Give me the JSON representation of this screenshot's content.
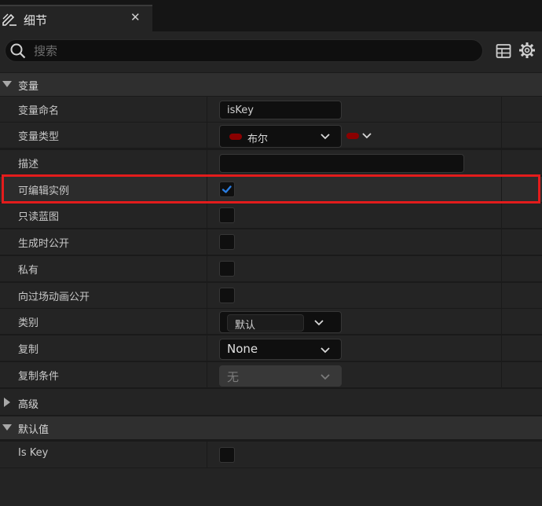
{
  "panel": {
    "title": "细节"
  },
  "search": {
    "placeholder": "搜索"
  },
  "sections": {
    "variable": "变量",
    "advanced": "高级",
    "default_value": "默认值"
  },
  "rows": {
    "var_name": {
      "label": "变量命名",
      "value": "isKey"
    },
    "var_type": {
      "label": "变量类型",
      "value": "布尔",
      "pill_color": "#8b0000"
    },
    "description": {
      "label": "描述",
      "value": ""
    },
    "instance_editable": {
      "label": "可编辑实例",
      "checked": true
    },
    "blueprint_read_only": {
      "label": "只读蓝图",
      "checked": false
    },
    "expose_on_spawn": {
      "label": "生成时公开",
      "checked": false
    },
    "private": {
      "label": "私有",
      "checked": false
    },
    "expose_to_cinematics": {
      "label": "向过场动画公开",
      "checked": false
    },
    "category": {
      "label": "类别",
      "value": "默认"
    },
    "replication": {
      "label": "复制",
      "value": "None"
    },
    "replication_condition": {
      "label": "复制条件",
      "value": "无"
    },
    "is_key": {
      "label": "Is Key",
      "checked": false
    }
  },
  "colors": {
    "highlight": "#e31c1c",
    "check_accent": "#2a7de1",
    "bool_pin": "#8b0000"
  }
}
